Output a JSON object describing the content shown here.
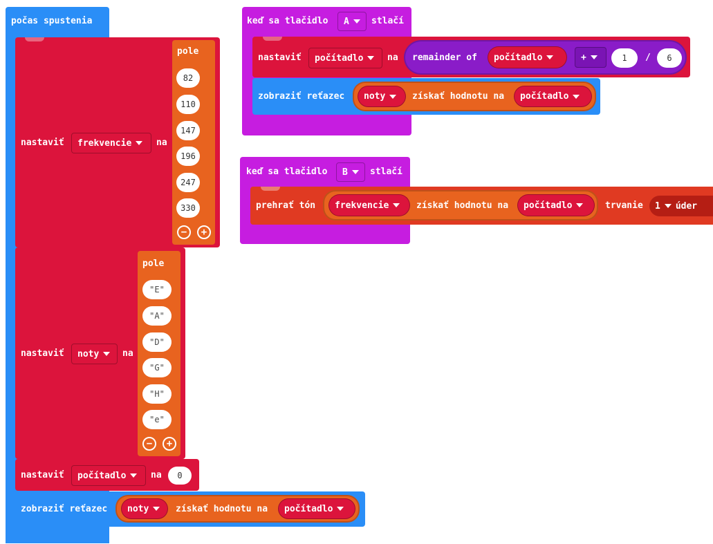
{
  "colors": {
    "event_blue": "#2a8ef7",
    "variable_red": "#dc143c",
    "array_orange": "#e8631f",
    "input_magenta": "#c61de0",
    "math_purple": "#8a1cc8"
  },
  "on_start": {
    "label": "počas spustenia",
    "set_freq": {
      "set_label": "nastaviť",
      "variable": "frekvencie",
      "to_label": "na",
      "array_label": "pole",
      "values": [
        "82",
        "110",
        "147",
        "196",
        "247",
        "330"
      ]
    },
    "set_notes": {
      "set_label": "nastaviť",
      "variable": "noty",
      "to_label": "na",
      "array_label": "pole",
      "values": [
        "E",
        "A",
        "D",
        "G",
        "H",
        "e"
      ]
    },
    "set_counter": {
      "set_label": "nastaviť",
      "variable": "počítadlo",
      "to_label": "na",
      "value": "0"
    },
    "show_string": {
      "label": "zobraziť reťazec",
      "array_var": "noty",
      "get_label": "získať hodnotu na",
      "index_var": "počítadlo"
    }
  },
  "button_a": {
    "event_label": "keď sa tlačidlo",
    "button": "A",
    "event_suffix": "stlačí",
    "set_label": "nastaviť",
    "variable": "počítadlo",
    "to_label": "na",
    "remainder_label": "remainder of",
    "operand_var": "počítadlo",
    "operator": "+",
    "add_value": "1",
    "divide_symbol": "/",
    "divisor": "6",
    "show_label": "zobraziť reťazec",
    "array_var": "noty",
    "get_label": "získať hodnotu na",
    "index_var": "počítadlo"
  },
  "button_b": {
    "event_label": "keď sa tlačidlo",
    "button": "B",
    "event_suffix": "stlačí",
    "play_label": "prehrať tón",
    "array_var": "frekvencie",
    "get_label": "získať hodnotu na",
    "index_var": "počítadlo",
    "duration_label": "trvanie",
    "duration": "1",
    "beat_label": "úder"
  }
}
